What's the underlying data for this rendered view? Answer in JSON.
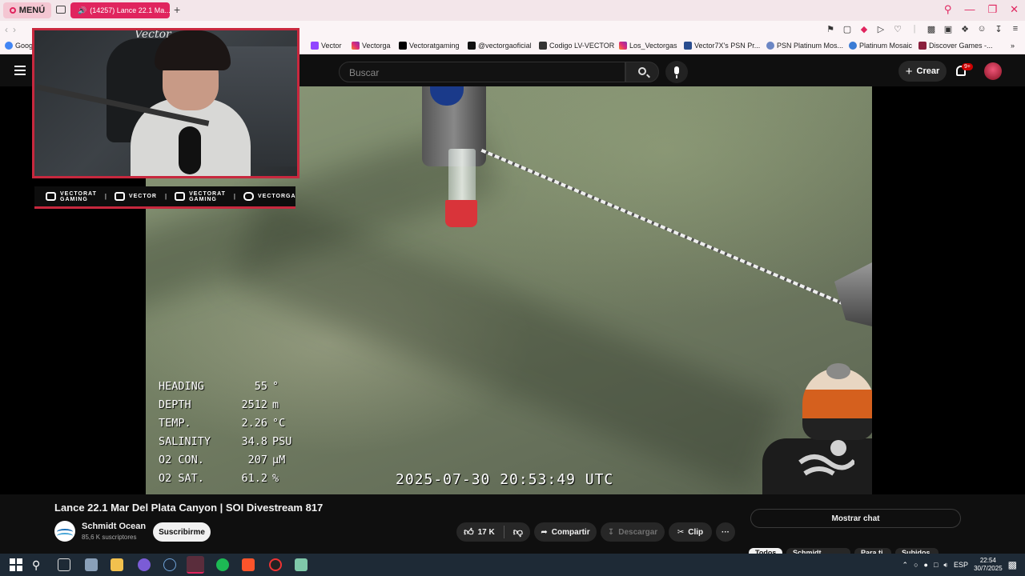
{
  "browser": {
    "menu_label": "MENÚ",
    "active_tab_title": "(14257) Lance 22.1 Ma...",
    "new_tab_symbol": "+",
    "window_controls": [
      "search-icon",
      "minimize-icon",
      "restore-icon",
      "close-icon"
    ],
    "bookmarks": [
      {
        "label": "Goog",
        "icon": "google-icon"
      },
      {
        "label": "Vector",
        "icon": "twitch-icon"
      },
      {
        "label": "Vectorga",
        "icon": "instagram-icon"
      },
      {
        "label": "Vectoratgaming",
        "icon": "x-icon"
      },
      {
        "label": "@vectorgaoficial",
        "icon": "tiktok-icon"
      },
      {
        "label": "Codigo LV-VECTOR",
        "icon": "code-icon"
      },
      {
        "label": "Los_Vectorgas",
        "icon": "instagram-icon"
      },
      {
        "label": "Vector7X's PSN Pr...",
        "icon": "psn-icon"
      },
      {
        "label": "PSN Platinum Mos...",
        "icon": "psn-icon"
      },
      {
        "label": "Platinum Mosaic",
        "icon": "gear-icon"
      },
      {
        "label": "Discover Games -...",
        "icon": "games-icon"
      }
    ]
  },
  "youtube": {
    "search_placeholder": "Buscar",
    "create_label": "Crear",
    "notif_count": "9+"
  },
  "webcam": {
    "overlay_name": "Vector",
    "socials": [
      {
        "line1": "VECTORAT",
        "line2": "GAMING",
        "icon": "youtube-icon"
      },
      {
        "line1": "VECTOR",
        "line2": "",
        "icon": "twitch-icon"
      },
      {
        "line1": "VECTORAT",
        "line2": "GAMING",
        "icon": "twitter-icon"
      },
      {
        "line1": "VECTORGA",
        "line2": "",
        "icon": "instagram-icon"
      }
    ]
  },
  "telemetry": [
    {
      "label": "HEADING",
      "value": "55",
      "unit": "°"
    },
    {
      "label": "DEPTH",
      "value": "2512",
      "unit": "m"
    },
    {
      "label": "TEMP.",
      "value": "2.26",
      "unit": "°C"
    },
    {
      "label": "SALINITY",
      "value": "34.8",
      "unit": "PSU"
    },
    {
      "label": "O2 CON.",
      "value": "207",
      "unit": "μM"
    },
    {
      "label": "O2 SAT.",
      "value": "61.2",
      "unit": "%"
    }
  ],
  "video_timestamp": "2025-07-30 20:53:49 UTC",
  "video": {
    "title": "Lance 22.1 Mar Del Plata Canyon | SOI Divestream 817",
    "channel": "Schmidt Ocean",
    "subscribers": "85,6 K suscriptores",
    "subscribe_label": "Suscribirme",
    "likes": "17 K",
    "share_label": "Compartir",
    "download_label": "Descargar",
    "clip_label": "Clip",
    "more_label": "···",
    "chat_label": "Mostrar chat",
    "chips": [
      "Todos",
      "Schmidt Ocean",
      "Para ti",
      "Subidos re..."
    ]
  },
  "taskbar": {
    "language": "ESP",
    "time": "22:54",
    "date": "30/7/2025"
  },
  "colors": {
    "accent": "#e0245e",
    "overlay_red": "#c8283e",
    "yt_bg": "#0f0f0f"
  }
}
